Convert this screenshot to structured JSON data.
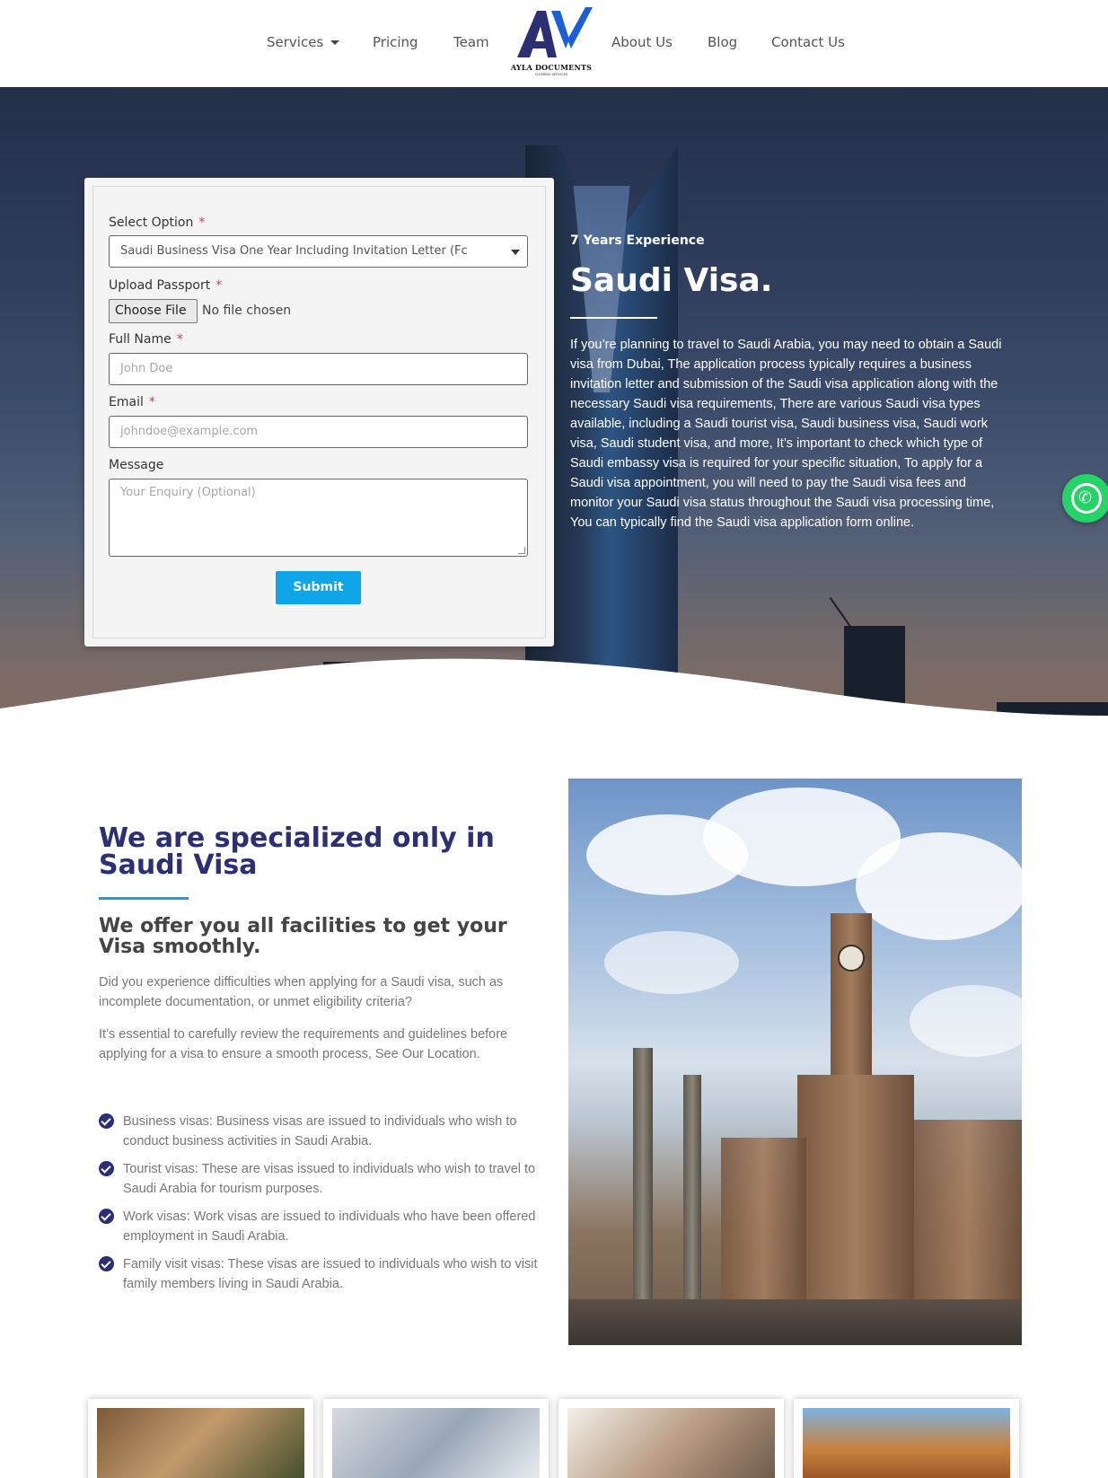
{
  "nav": {
    "items_left": [
      "Services",
      "Pricing",
      "Team"
    ],
    "items_right": [
      "About Us",
      "Blog",
      "Contact Us"
    ],
    "logo_name": "AYLA DOCUMENTS",
    "logo_sub": "CLEARING SERVICES"
  },
  "form": {
    "select_label": "Select Option",
    "select_value": "Saudi Business Visa One Year Including Invitation Letter (Fc",
    "passport_label": "Upload Passport",
    "file_button": "Choose File",
    "file_status": "No file chosen",
    "name_label": "Full Name",
    "name_placeholder": "John Doe",
    "email_label": "Email",
    "email_placeholder": "johndoe@example.com",
    "message_label": "Message",
    "message_placeholder": "Your Enquiry (Optional)",
    "required_mark": "*",
    "submit_label": "Submit"
  },
  "hero": {
    "kicker": "7 Years Experience",
    "title": "Saudi Visa.",
    "text": "If you’re planning to travel to Saudi Arabia, you may need to obtain a Saudi visa from Dubai, The application process typically requires a business invitation letter and submission of the Saudi visa application along with the necessary Saudi visa requirements, There are various Saudi visa types available, including a Saudi tourist visa, Saudi business visa, Saudi work visa, Saudi student visa, and more, It’s important to check which type of Saudi embassy visa is required for your specific situation, To apply for a Saudi visa appointment, you will need to pay the Saudi visa fees and monitor your Saudi visa status throughout the Saudi visa processing time, You can typically find the Saudi visa application form online."
  },
  "specialized": {
    "title": "We are specialized only in Saudi Visa",
    "subtitle": "We offer you all facilities to get your Visa smoothly.",
    "p1": "Did you experience difficulties when applying for a Saudi visa, such as incomplete documentation, or unmet eligibility criteria?",
    "p2": "It’s essential to carefully review the requirements and guidelines before applying for a visa to ensure a smooth process, See Our Location.",
    "bullets": [
      "Business visas: Business visas are issued to individuals who wish to conduct business activities in Saudi Arabia.",
      "Tourist visas: These are visas issued to individuals who wish to travel to Saudi Arabia for tourism purposes.",
      "Work visas: Work visas are issued to individuals who have been offered employment in Saudi Arabia.",
      "Family visit visas: These visas are issued to individuals who wish to visit family members living in Saudi Arabia."
    ]
  },
  "icons": {
    "dropdown": "caret-down-icon",
    "whatsapp": "whatsapp-icon",
    "check": "check-circle-icon"
  },
  "colors": {
    "accent": "#0ea5e9",
    "heading": "#2c2f73",
    "rule": "#1a9ee0",
    "whatsapp": "#25d366"
  }
}
